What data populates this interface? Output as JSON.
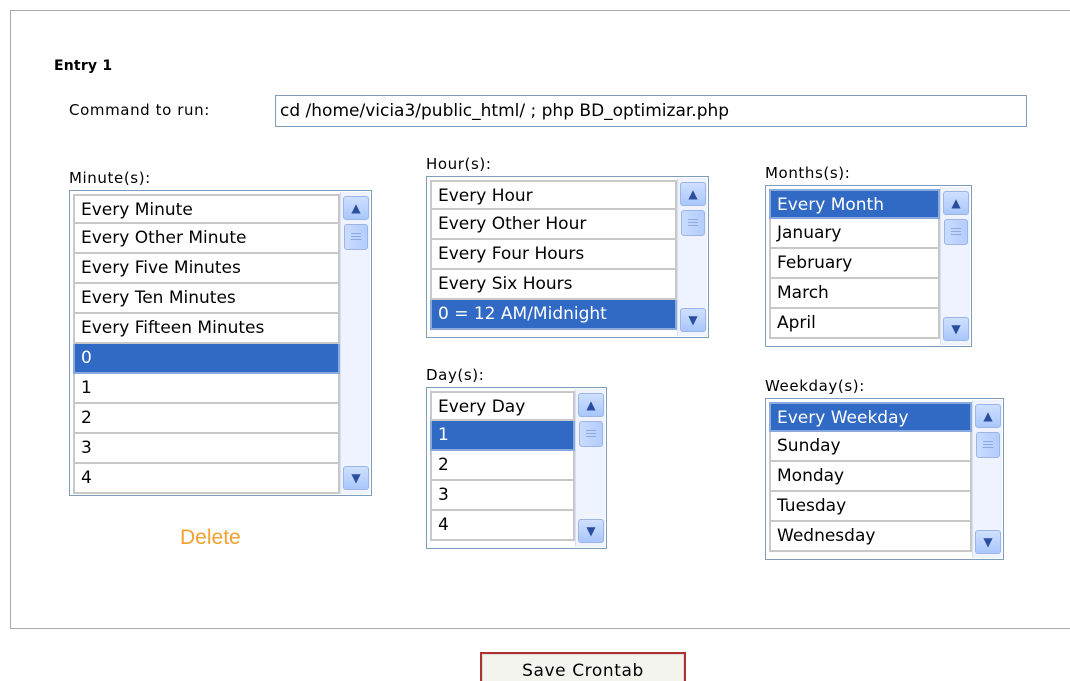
{
  "entry": {
    "title": "Entry 1",
    "command_label": "Command to run:",
    "command_value": "cd /home/vicia3/public_html/ ; php BD_optimizar.php"
  },
  "minutes": {
    "label": "Minute(s):",
    "items": [
      "Every Minute",
      "Every Other Minute",
      "Every Five Minutes",
      "Every Ten Minutes",
      "Every Fifteen Minutes",
      "0",
      "1",
      "2",
      "3",
      "4"
    ],
    "selected": "0"
  },
  "hours": {
    "label": "Hour(s):",
    "items": [
      "Every Hour",
      "Every Other Hour",
      "Every Four Hours",
      "Every Six Hours",
      "0 = 12 AM/Midnight"
    ],
    "selected": "0 = 12 AM/Midnight"
  },
  "days": {
    "label": "Day(s):",
    "items": [
      "Every Day",
      "1",
      "2",
      "3",
      "4"
    ],
    "selected": "1"
  },
  "months": {
    "label": "Months(s):",
    "items": [
      "Every Month",
      "January",
      "February",
      "March",
      "April"
    ],
    "selected": "Every Month"
  },
  "weekdays": {
    "label": "Weekday(s):",
    "items": [
      "Every Weekday",
      "Sunday",
      "Monday",
      "Tuesday",
      "Wednesday"
    ],
    "selected": "Every Weekday"
  },
  "actions": {
    "delete_label": "Delete",
    "save_label": "Save Crontab"
  },
  "colors": {
    "selection": "#316ac5",
    "delete_link": "#f0a030",
    "save_border": "#b03030"
  }
}
